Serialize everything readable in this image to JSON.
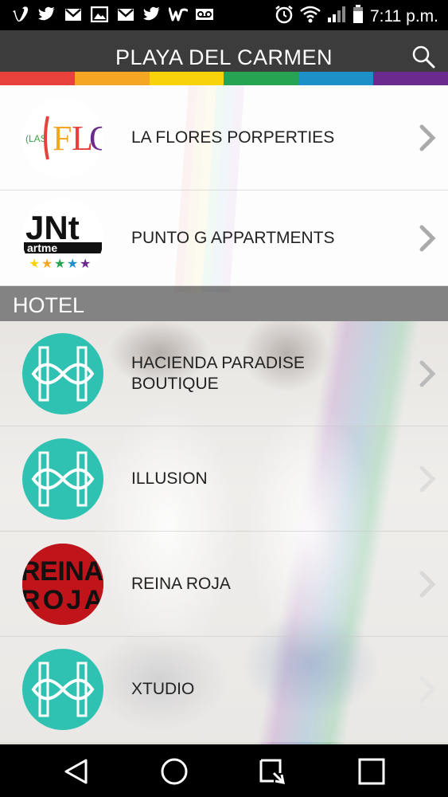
{
  "status_bar": {
    "left_icons": [
      "vimeo-icon",
      "twitter-icon",
      "gmail-icon",
      "gallery-icon",
      "gmail-icon",
      "twitter-icon",
      "wattpad-icon",
      "voicemail-icon"
    ],
    "right_icons": [
      "alarm-icon",
      "wifi-icon",
      "signal-icon",
      "battery-icon"
    ],
    "time": "7:11 p.m."
  },
  "header": {
    "title": "PLAYA DEL CARMEN",
    "search_icon": "search-icon",
    "rainbow_colors": [
      "#e8413c",
      "#f5a623",
      "#f8d20a",
      "#27a451",
      "#1e90c8",
      "#6b2a8e"
    ]
  },
  "list_top": [
    {
      "label": "LA FLORES PORPERTIES",
      "logo_text": "(LAS )FLO",
      "icon": "chevron-right-icon"
    },
    {
      "label": "PUNTO G APPARTMENTS",
      "logo_text": "JNT artme",
      "icon": "chevron-right-icon"
    }
  ],
  "section": {
    "title": "HOTEL"
  },
  "list_hotel": [
    {
      "label": "HACIENDA PARADISE BOUTIQUE",
      "logo": "infinity-logo",
      "icon": "chevron-right-icon"
    },
    {
      "label": "ILLUSION",
      "logo": "infinity-logo",
      "icon": "chevron-right-icon"
    },
    {
      "label": "REINA ROJA",
      "logo_text": "REINA ROJA",
      "icon": "chevron-right-icon"
    },
    {
      "label": "XTUDIO",
      "logo": "infinity-logo",
      "icon": "chevron-right-icon"
    }
  ],
  "colors": {
    "accent_teal": "#2fc1b1",
    "header_bg": "#3c3c3c",
    "reina_red": "#c0141b"
  },
  "nav_bar": [
    "back-icon",
    "home-icon",
    "assist-icon",
    "recents-icon"
  ]
}
